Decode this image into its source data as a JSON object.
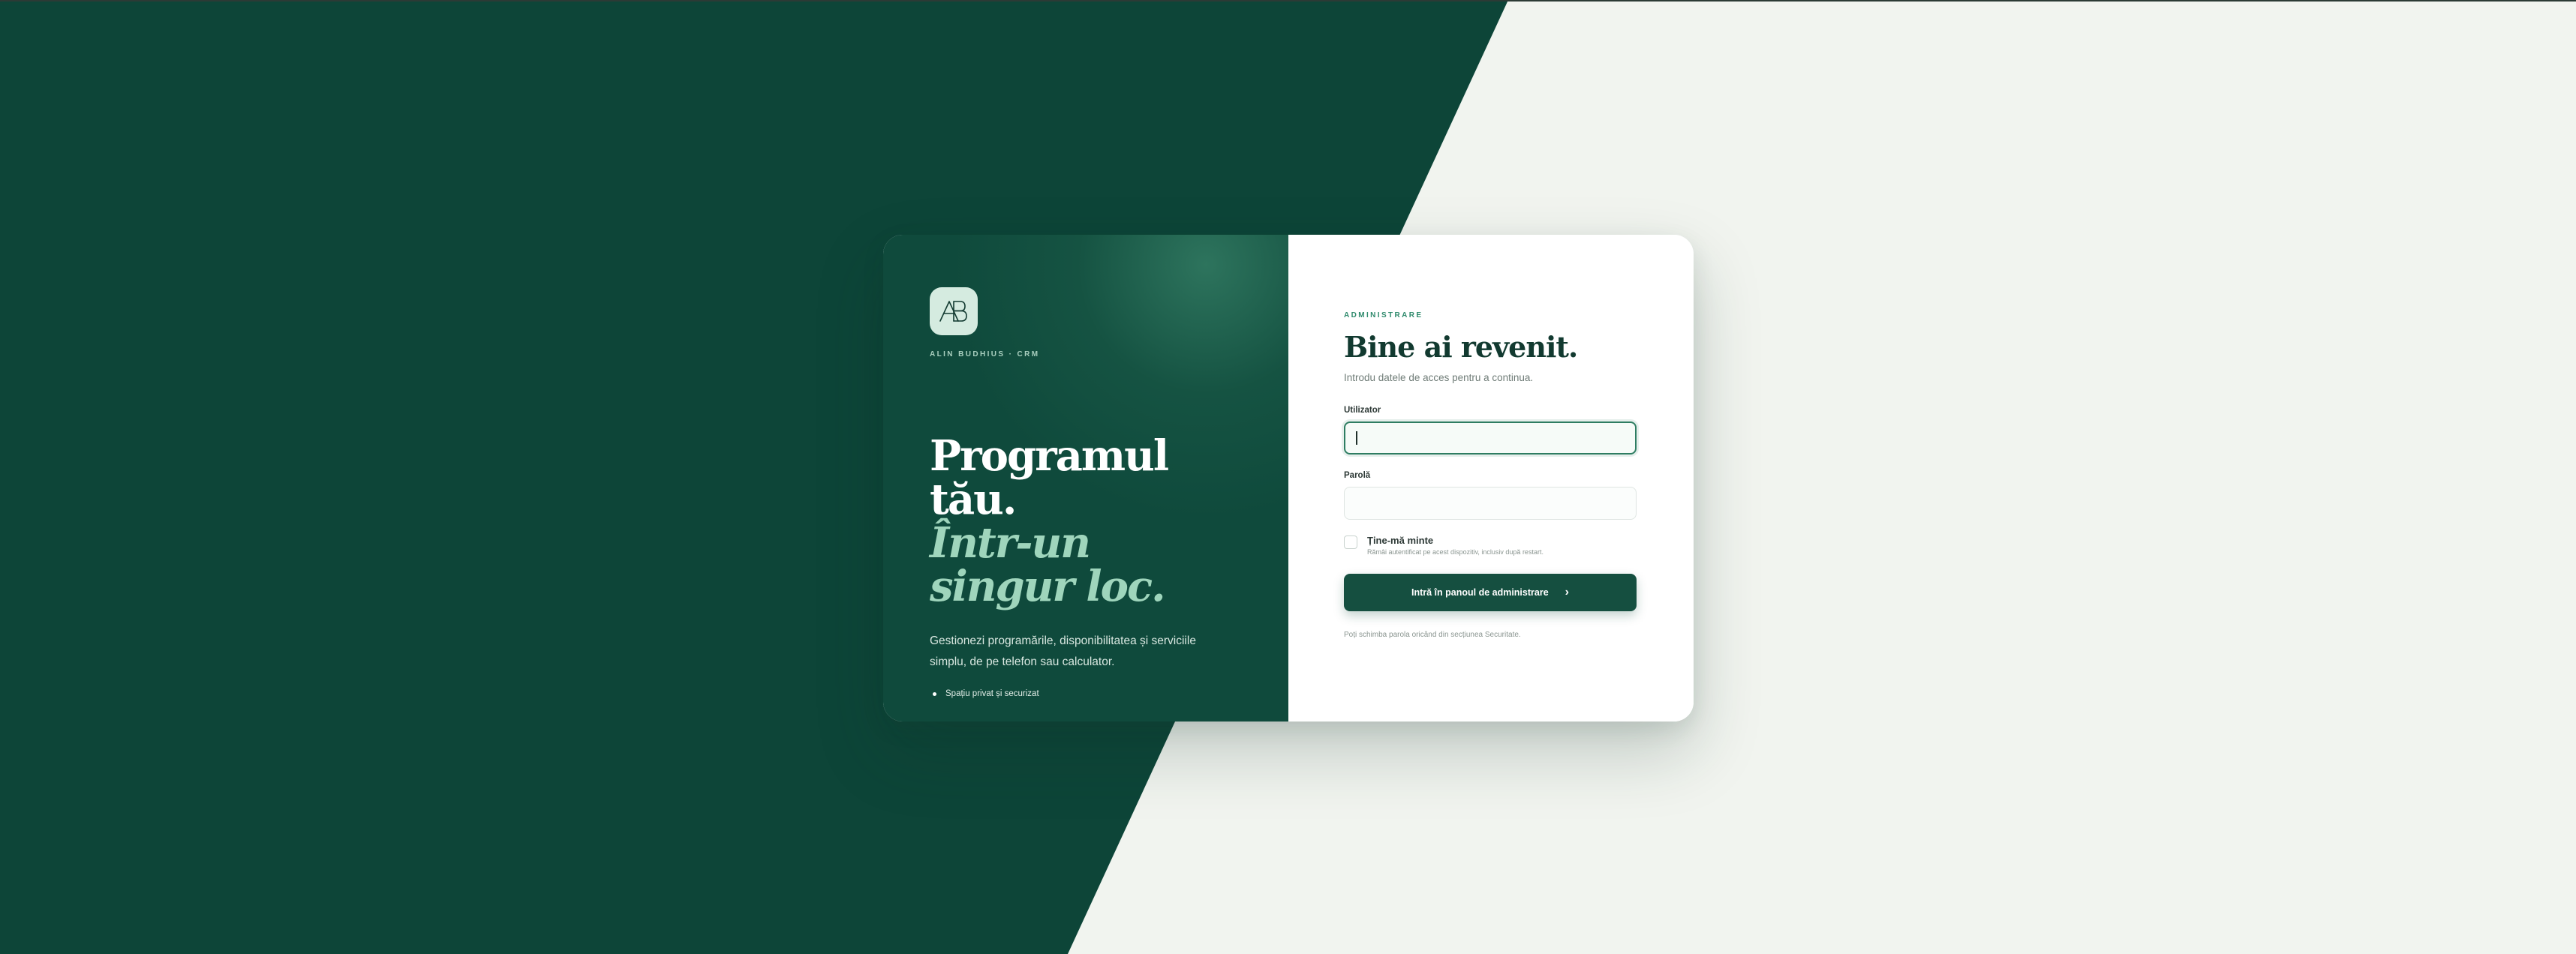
{
  "brand": {
    "logo_text": "AB",
    "name": "ALIN BUDHIUS · CRM"
  },
  "hero": {
    "headline_line1": "Programul tău.",
    "headline_line2": "Într-un singur loc.",
    "description": "Gestionezi programările, disponibilitatea și serviciile simplu, de pe telefon sau calculator.",
    "bullet": "Spațiu privat și securizat"
  },
  "login": {
    "eyebrow": "ADMINISTRARE",
    "title": "Bine ai revenit.",
    "subtitle": "Introdu datele de acces pentru a continua.",
    "username_label": "Utilizator",
    "username_value": "",
    "password_label": "Parolă",
    "password_value": "",
    "remember_label": "Ține-mă minte",
    "remember_hint": "Rămâi autentificat pe acest dispozitiv, inclusiv după restart.",
    "remember_checked": false,
    "submit_label": "Intră în panoul de administrare",
    "footer_note": "Poți schimba parola oricând din secțiunea Securitate."
  },
  "colors": {
    "brand_green": "#0d4538",
    "accent_green": "#9fd5bc",
    "button": "#154f40",
    "background_light": "#f1f4ef"
  }
}
